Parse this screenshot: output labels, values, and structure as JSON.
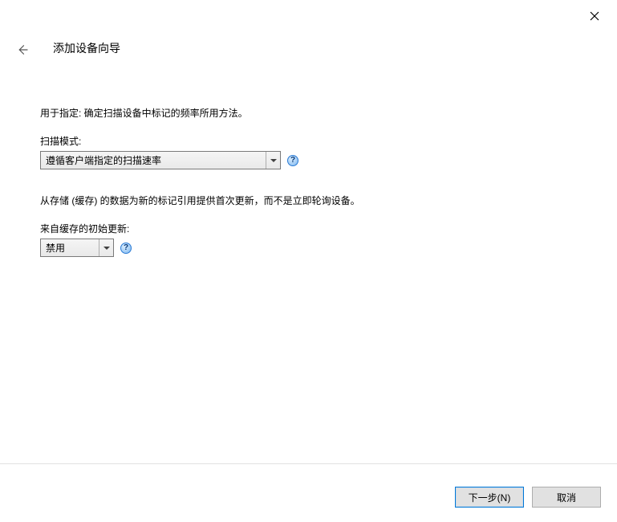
{
  "header": {
    "title": "添加设备向导"
  },
  "section1": {
    "desc": "用于指定: 确定扫描设备中标记的频率所用方法。",
    "label": "扫描模式:",
    "selected": "遵循客户端指定的扫描速率"
  },
  "section2": {
    "desc": "从存储 (缓存) 的数据为新的标记引用提供首次更新，而不是立即轮询设备。",
    "label": "来自缓存的初始更新:",
    "selected": "禁用"
  },
  "help_glyph": "?",
  "footer": {
    "next": "下一步(N)",
    "cancel": "取消"
  }
}
